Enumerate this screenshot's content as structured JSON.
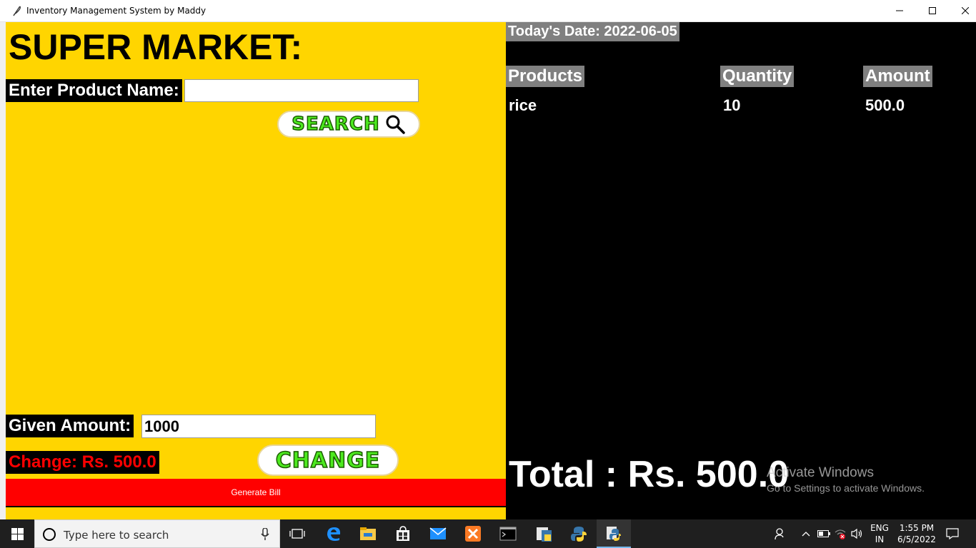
{
  "window": {
    "title": "Inventory Management System by Maddy"
  },
  "left": {
    "heading": "SUPER MARKET:",
    "product_label": "Enter Product Name:",
    "product_value": "",
    "search_button": "SEARCH",
    "given_label": "Given Amount:",
    "given_value": "1000",
    "change_label": "Change: Rs. 500.0",
    "change_button": "CHANGE",
    "generate_bill": "Generate Bill"
  },
  "right": {
    "date": "Today's Date: 2022-06-05",
    "columns": [
      "Products",
      "Quantity",
      "Amount"
    ],
    "rows": [
      {
        "product": "rice",
        "quantity": "10",
        "amount": "500.0"
      }
    ],
    "total": "Total : Rs. 500.0"
  },
  "watermark": {
    "line1": "Activate Windows",
    "line2": "Go to Settings to activate Windows."
  },
  "taskbar": {
    "search_placeholder": "Type here to search",
    "lang_top": "ENG",
    "lang_bottom": "IN",
    "time": "1:55 PM",
    "date": "6/5/2022"
  },
  "colors": {
    "panel": "#ffd500",
    "bill_bar": "#ff0000",
    "button_text": "#4dea1f",
    "header_bg": "#808080"
  }
}
